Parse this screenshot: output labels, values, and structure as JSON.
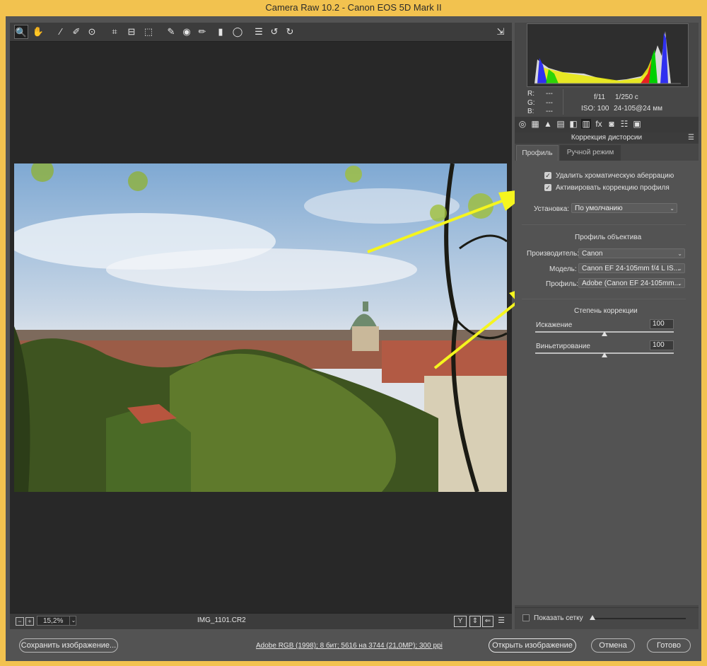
{
  "window": {
    "title": "Camera Raw 10.2  -  Canon EOS 5D Mark II"
  },
  "toolbar": {
    "tools": [
      {
        "name": "zoom-icon",
        "glyph": "🔍"
      },
      {
        "name": "hand-icon",
        "glyph": "✋"
      },
      {
        "name": "white-balance-icon",
        "glyph": "⁄"
      },
      {
        "name": "color-sampler-icon",
        "glyph": "✐"
      },
      {
        "name": "targeted-adjustment-icon",
        "glyph": "⊙"
      },
      {
        "name": "crop-icon",
        "glyph": "⌗"
      },
      {
        "name": "straighten-icon",
        "glyph": "⊟"
      },
      {
        "name": "transform-icon",
        "glyph": "⬚"
      },
      {
        "name": "spot-removal-icon",
        "glyph": "✎"
      },
      {
        "name": "red-eye-icon",
        "glyph": "◉"
      },
      {
        "name": "adjustment-brush-icon",
        "glyph": "✏"
      },
      {
        "name": "graduated-filter-icon",
        "glyph": "▮"
      },
      {
        "name": "radial-filter-icon",
        "glyph": "◯"
      },
      {
        "name": "preferences-icon",
        "glyph": "☰"
      },
      {
        "name": "rotate-left-icon",
        "glyph": "↺"
      },
      {
        "name": "rotate-right-icon",
        "glyph": "↻"
      }
    ],
    "export_icon": "⇲"
  },
  "histogram": {
    "r": "R:",
    "g": "G:",
    "b": "B:",
    "r_val": "---",
    "g_val": "---",
    "b_val": "---",
    "aperture": "f/11",
    "shutter": "1/250 с",
    "iso": "ISO: 100",
    "lens": "24-105@24 мм"
  },
  "panel_tabs": [
    "◎",
    "▦",
    "▲",
    "▤",
    "◧",
    "▥",
    "fx",
    "◙",
    "☷",
    "▣"
  ],
  "panel": {
    "title": "Коррекция дисторсии",
    "tab_profile": "Профиль",
    "tab_manual": "Ручной режим",
    "chk_ca": "Удалить хроматическую аберрацию",
    "chk_profile": "Активировать коррекцию профиля",
    "setup_label": "Установка:",
    "setup_value": "По умолчанию",
    "lens_profile_header": "Профиль объектива",
    "make_label": "Производитель:",
    "make_value": "Canon",
    "model_label": "Модель:",
    "model_value": "Canon EF 24-105mm f/4 L IS...",
    "profile_label": "Профиль:",
    "profile_value": "Adobe (Canon EF 24-105mm...",
    "amount_header": "Степень коррекции",
    "distortion_label": "Искажение",
    "distortion_value": "100",
    "vignetting_label": "Виньетирование",
    "vignetting_value": "100",
    "distortion_level": 0.5,
    "vignetting_level": 0.5,
    "show_grid": "Показать сетку"
  },
  "bottom": {
    "zoom": "15,2%",
    "filename": "IMG_1101.CR2",
    "minus": "−",
    "plus": "+"
  },
  "footer": {
    "save": "Сохранить изображение...",
    "workflow": "Adobe RGB (1998); 8 бит; 5616 на 3744 (21,0MP); 300 ppi",
    "open": "Открыть изображение",
    "cancel": "Отмена",
    "done": "Готово"
  },
  "colors": {
    "annotation_arrow": "#f5f51e"
  }
}
